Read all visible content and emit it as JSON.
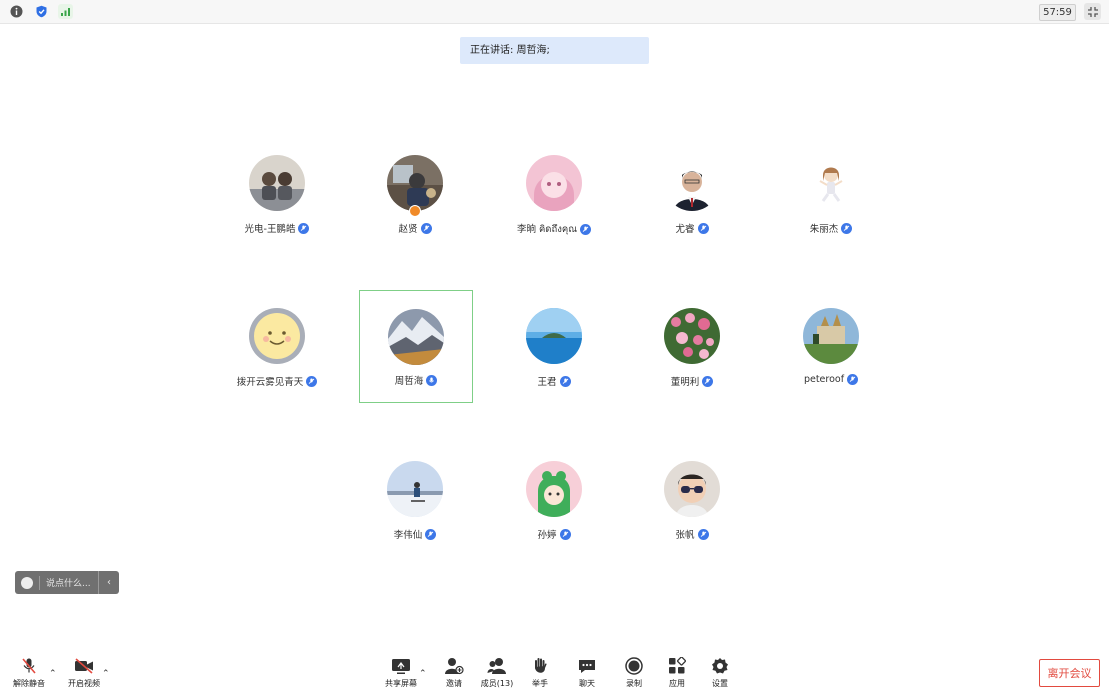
{
  "topbar": {
    "timer": "57:59",
    "icons": [
      "info-icon",
      "shield-icon",
      "signal-icon",
      "shrink-icon"
    ]
  },
  "speaking": {
    "text": "正在讲话: 周哲海;"
  },
  "participants": [
    {
      "name": "光电-王鹏皓"
    },
    {
      "name": "赵贤"
    },
    {
      "name": "李晌 คิดถึงคุณ"
    },
    {
      "name": "尤睿"
    },
    {
      "name": "朱丽杰"
    },
    {
      "name": "拨开云雾见青天"
    },
    {
      "name": "周哲海"
    },
    {
      "name": "王君"
    },
    {
      "name": "董明利"
    },
    {
      "name": "peteroof"
    },
    {
      "name": "李伟仙"
    },
    {
      "name": "孙婷"
    },
    {
      "name": "张帆"
    }
  ],
  "chat": {
    "placeholder": "说点什么..."
  },
  "toolbar": {
    "unmute": "解除静音",
    "start_video": "开启视频",
    "share_screen": "共享屏幕",
    "invite": "邀请",
    "members": "成员(13)",
    "raise_hand": "举手",
    "chat": "聊天",
    "record": "录制",
    "apps": "应用",
    "settings": "设置",
    "leave": "离开会议"
  },
  "colors": {
    "accent": "#3d77e8",
    "leave": "#e24a3f",
    "active_border": "#7fcf87",
    "speaking_bg": "#dde9fb"
  }
}
